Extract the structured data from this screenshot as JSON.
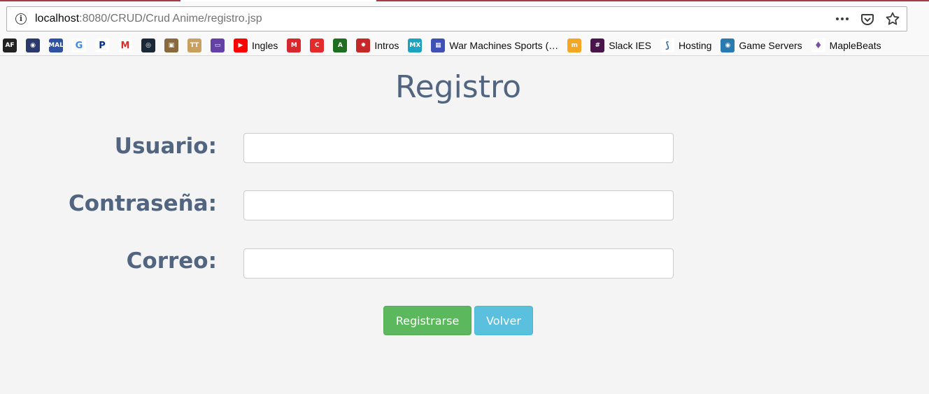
{
  "browser": {
    "url_host": "localhost",
    "url_rest": ":8080/CRUD/Crud Anime/registro.jsp",
    "actions": [
      "more-icon",
      "pocket-icon",
      "bookmark-star-icon"
    ]
  },
  "bookmarks": [
    {
      "icon": "animeflv-icon",
      "label": "",
      "color": "#222222",
      "glyph": "AF"
    },
    {
      "icon": "anime-site-icon",
      "label": "",
      "color": "#2b3a6b",
      "glyph": "◉"
    },
    {
      "icon": "myanimelist-icon",
      "label": "",
      "color": "#2e51a2",
      "glyph": "MAL"
    },
    {
      "icon": "google-icon",
      "label": "",
      "color": "#ffffff",
      "glyph": "G"
    },
    {
      "icon": "paypal-icon",
      "label": "",
      "color": "#ffffff",
      "glyph": "P"
    },
    {
      "icon": "gmail-icon",
      "label": "",
      "color": "#ffffff",
      "glyph": "M"
    },
    {
      "icon": "steam-icon",
      "label": "",
      "color": "#1b2838",
      "glyph": "◎"
    },
    {
      "icon": "package-icon",
      "label": "",
      "color": "#8a6a3c",
      "glyph": "▣"
    },
    {
      "icon": "tt-icon",
      "label": "",
      "color": "#c8a060",
      "glyph": "TT"
    },
    {
      "icon": "twitch-icon",
      "label": "",
      "color": "#6441a5",
      "glyph": "▭"
    },
    {
      "icon": "youtube-icon",
      "label": "Ingles",
      "color": "#ff0000",
      "glyph": "▶"
    },
    {
      "icon": "mega-icon",
      "label": "",
      "color": "#d9272e",
      "glyph": "M"
    },
    {
      "icon": "red-c-icon",
      "label": "",
      "color": "#e32b2b",
      "glyph": "C"
    },
    {
      "icon": "android-icon",
      "label": "",
      "color": "#1f6d1f",
      "glyph": "A"
    },
    {
      "icon": "gear-red-icon",
      "label": "Intros",
      "color": "#c62828",
      "glyph": "✹"
    },
    {
      "icon": "mx-icon",
      "label": "",
      "color": "#1ba3c0",
      "glyph": "MX"
    },
    {
      "icon": "window-icon",
      "label": "War Machines Sports (…",
      "color": "#3f51b5",
      "glyph": "▦"
    },
    {
      "icon": "moodle-icon",
      "label": "",
      "color": "#f5a623",
      "glyph": "m"
    },
    {
      "icon": "slack-icon",
      "label": "Slack IES",
      "color": "#4a154b",
      "glyph": "#"
    },
    {
      "icon": "hosting-icon",
      "label": "Hosting",
      "color": "#ffffff",
      "glyph": "⟆"
    },
    {
      "icon": "game-servers-icon",
      "label": "Game Servers",
      "color": "#2a7ab0",
      "glyph": "◉"
    },
    {
      "icon": "maplebeats-icon",
      "label": "MapleBeats",
      "color": "#ffffff",
      "glyph": "♦"
    }
  ],
  "form": {
    "title": "Registro",
    "fields": [
      {
        "label": "Usuario:",
        "value": ""
      },
      {
        "label": "Contraseña:",
        "value": ""
      },
      {
        "label": "Correo:",
        "value": ""
      }
    ],
    "submit_label": "Registrarse",
    "back_label": "Volver"
  },
  "colors": {
    "label": "#526580",
    "success": "#5cb85c",
    "info": "#5bc0de"
  }
}
